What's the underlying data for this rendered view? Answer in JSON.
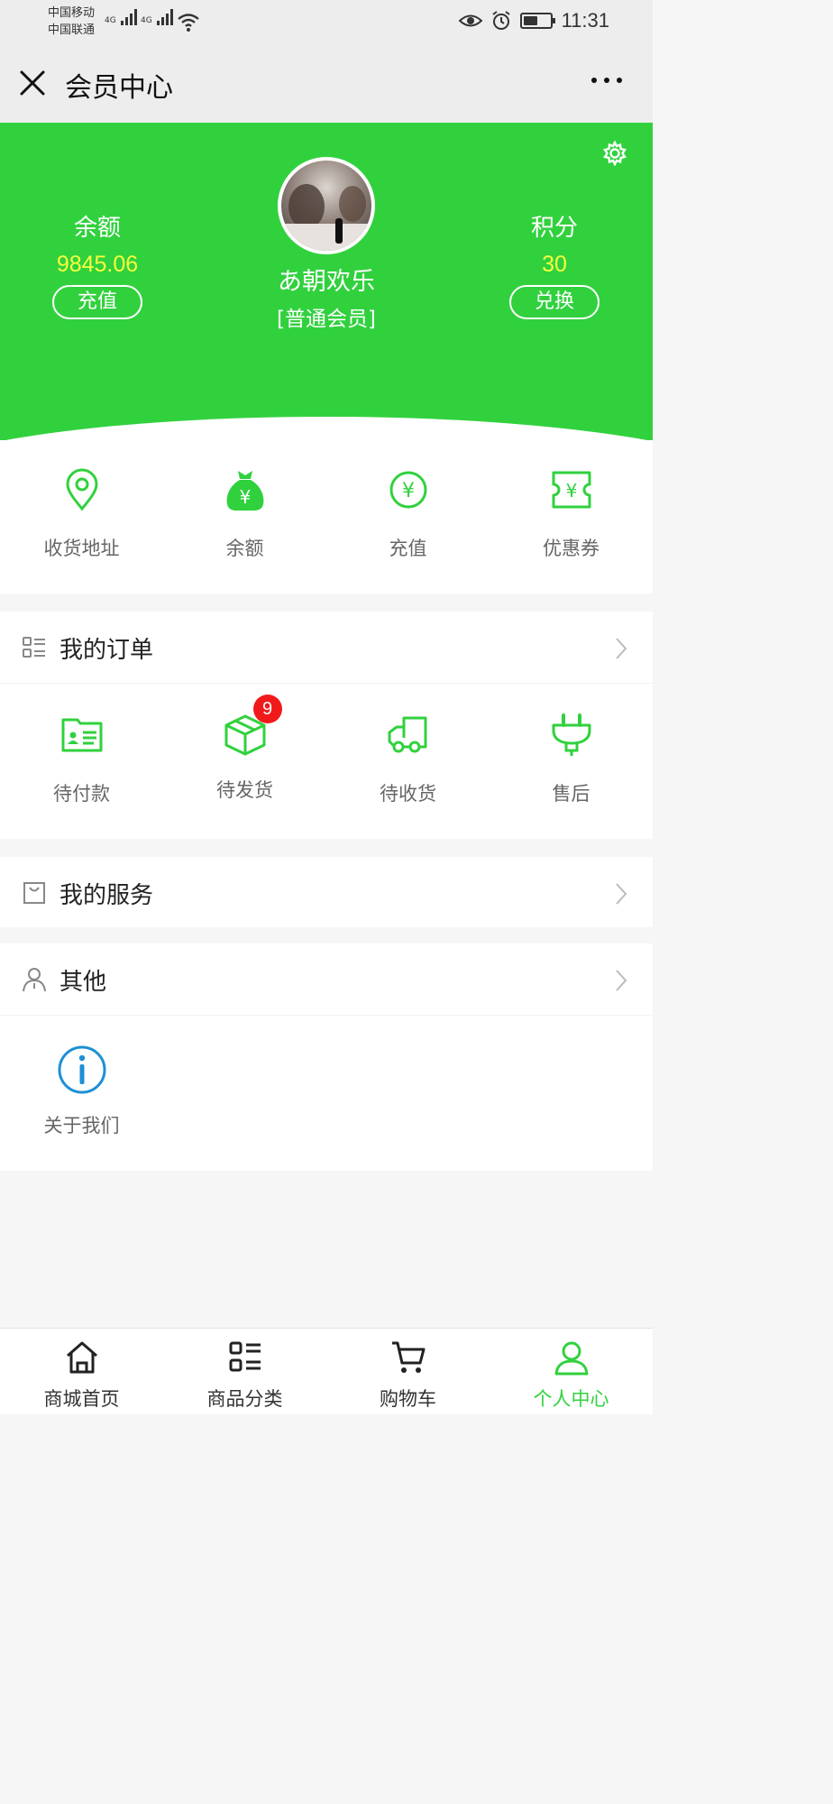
{
  "status": {
    "carrier1": "中国移动",
    "carrier2": "中国联通",
    "net1": "4G",
    "net2": "4G",
    "time": "11:31",
    "battery_level": 0.55
  },
  "nav": {
    "title": "会员中心"
  },
  "member": {
    "balance_label": "余额",
    "balance_value": "9845.06",
    "recharge_btn": "充值",
    "points_label": "积分",
    "points_value": "30",
    "exchange_btn": "兑换",
    "username": "あ朝欢乐",
    "level": "[普通会员]"
  },
  "quick": [
    {
      "label": "收货地址",
      "icon": "location-pin-icon"
    },
    {
      "label": "余额",
      "icon": "money-bag-icon"
    },
    {
      "label": "充值",
      "icon": "yen-circle-icon"
    },
    {
      "label": "优惠券",
      "icon": "coupon-icon"
    }
  ],
  "orders": {
    "title": "我的订单",
    "items": [
      {
        "label": "待付款",
        "icon": "wallet-card-icon"
      },
      {
        "label": "待发货",
        "icon": "package-box-icon",
        "badge": "9"
      },
      {
        "label": "待收货",
        "icon": "truck-icon"
      },
      {
        "label": "售后",
        "icon": "plug-icon"
      }
    ]
  },
  "services": {
    "title": "我的服务"
  },
  "other": {
    "title": "其他",
    "items": [
      {
        "label": "关于我们",
        "icon": "info-circle-icon"
      }
    ]
  },
  "tabbar": [
    {
      "label": "商城首页",
      "icon": "home-icon"
    },
    {
      "label": "商品分类",
      "icon": "category-list-icon"
    },
    {
      "label": "购物车",
      "icon": "cart-icon"
    },
    {
      "label": "个人中心",
      "icon": "user-icon",
      "active": true
    }
  ],
  "colors": {
    "accent": "#31d13e",
    "highlight": "#f6ff3c",
    "badge": "#f01a1a",
    "info": "#1e8fd6"
  }
}
